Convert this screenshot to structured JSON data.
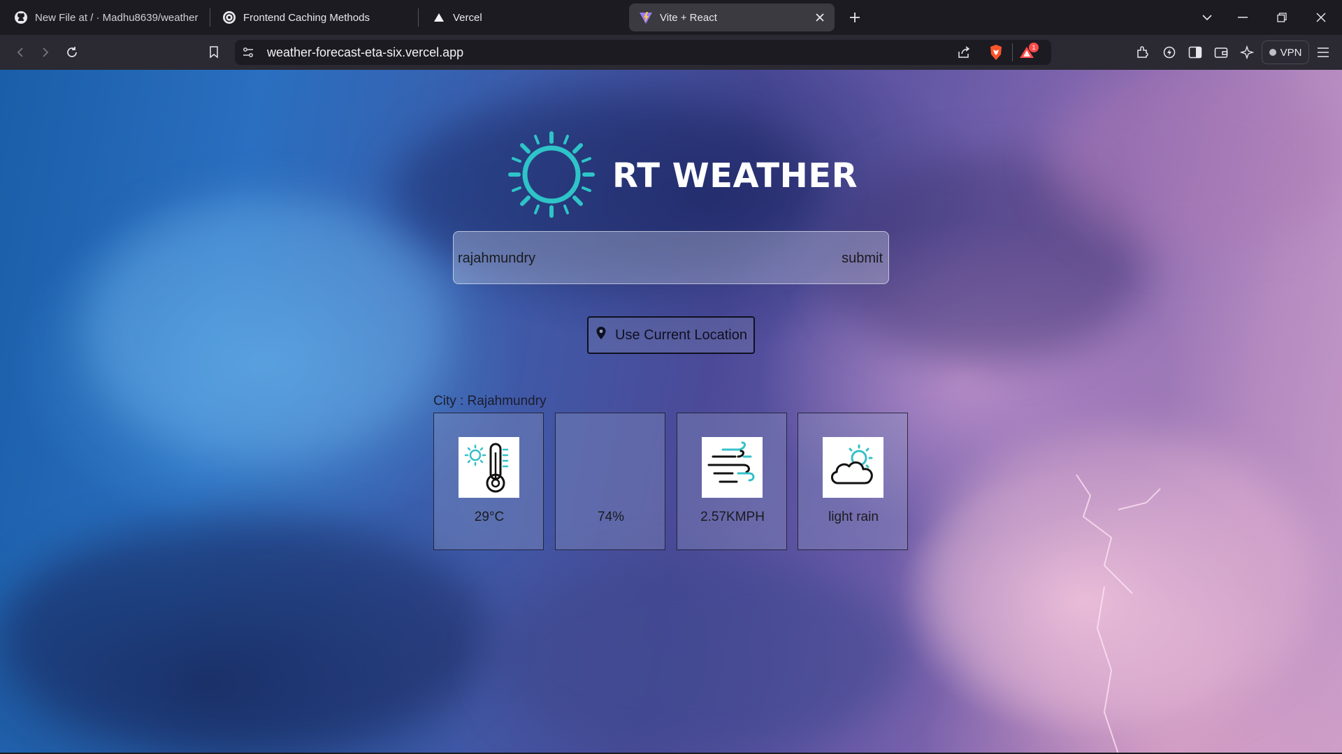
{
  "browser": {
    "tabs": [
      {
        "title": "New File at / · Madhu8639/weather",
        "favicon": "github-icon",
        "active": false
      },
      {
        "title": "Frontend Caching Methods",
        "favicon": "chatgpt-icon",
        "active": false
      },
      {
        "title": "Vercel",
        "favicon": "vercel-icon",
        "active": false
      },
      {
        "title": "Vite + React",
        "favicon": "vite-icon",
        "active": true
      }
    ],
    "url": "weather-forecast-eta-six.vercel.app",
    "notification_count": "1",
    "vpn_label": "VPN"
  },
  "app": {
    "title": "RT WEATHER",
    "search": {
      "value": "rajahmundry",
      "submit_label": "submit"
    },
    "location_button_label": "Use Current Location",
    "city_line": "City : Rajahmundry",
    "cards": [
      {
        "icon": "thermometer-icon",
        "value": "29°C"
      },
      {
        "icon": "",
        "value": "74%"
      },
      {
        "icon": "wind-icon",
        "value": "2.57KMPH"
      },
      {
        "icon": "partly-cloudy-icon",
        "value": "light rain"
      }
    ],
    "colors": {
      "accent_sun": "#2ec4c8",
      "icon_teal": "#35c0c8"
    }
  }
}
